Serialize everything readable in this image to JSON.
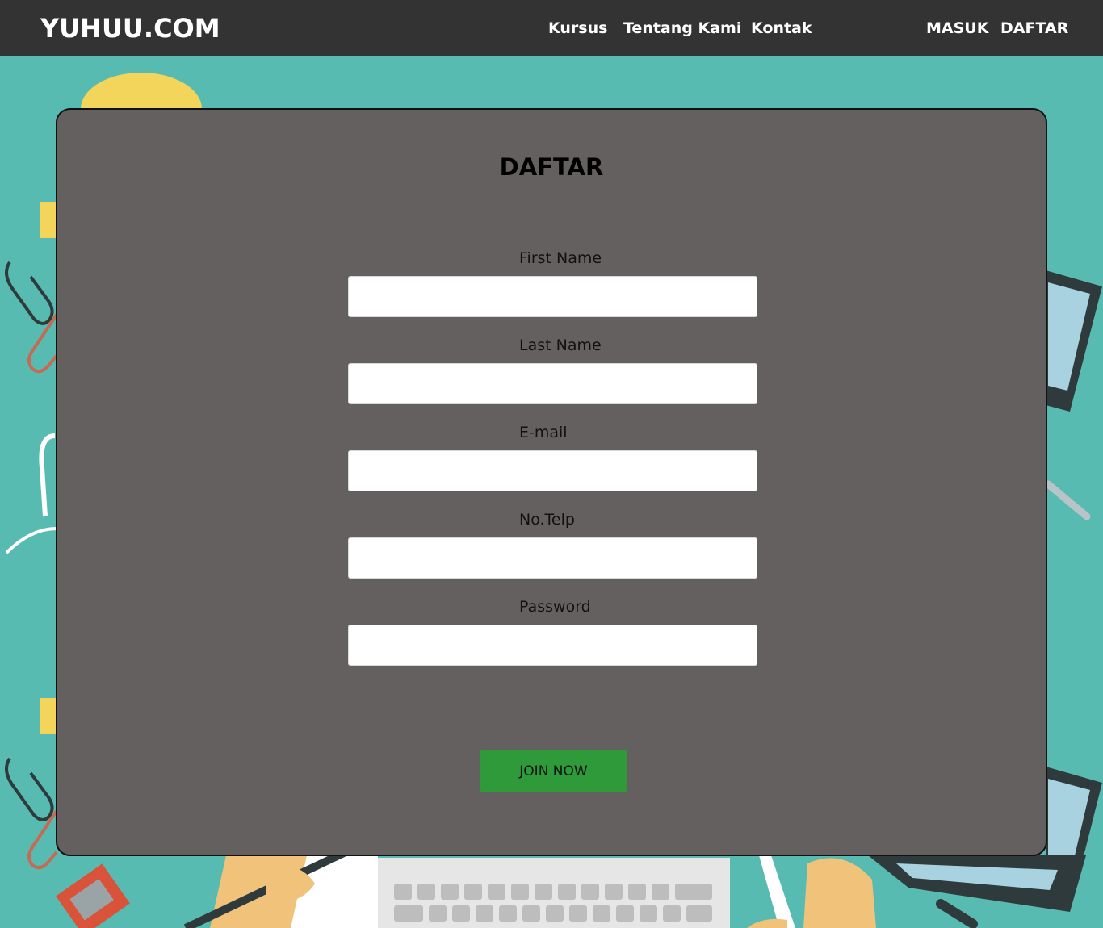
{
  "navbar": {
    "brand": "YUHUU.COM",
    "links": [
      "Kursus",
      "Tentang Kami",
      "Kontak"
    ],
    "auth": {
      "login": "MASUK",
      "register": "DAFTAR"
    }
  },
  "form": {
    "title": "DAFTAR",
    "fields": [
      {
        "label": "First Name",
        "value": "",
        "placeholder": ""
      },
      {
        "label": "Last Name",
        "value": "",
        "placeholder": ""
      },
      {
        "label": "E-mail",
        "value": "",
        "placeholder": ""
      },
      {
        "label": "No.Telp",
        "value": "",
        "placeholder": ""
      },
      {
        "label": "Password",
        "value": "",
        "placeholder": ""
      }
    ],
    "submit_label": "JOIN NOW"
  },
  "colors": {
    "navbar": "#333333",
    "background": "#57bbb1",
    "card": "#656060",
    "button": "#2e9a3a"
  }
}
